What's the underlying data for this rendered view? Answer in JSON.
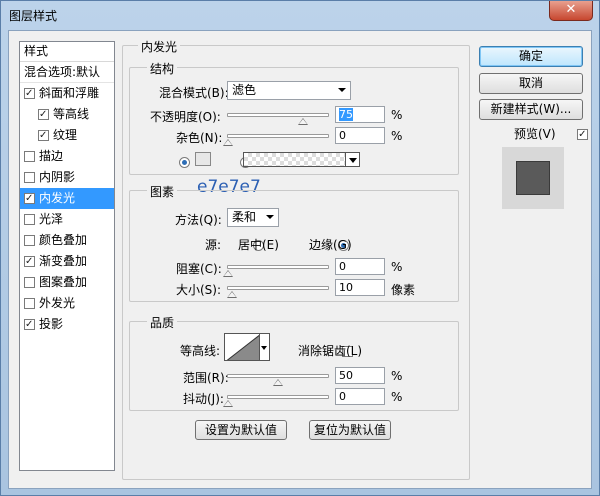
{
  "window": {
    "title": "图层样式",
    "close_glyph": "✕"
  },
  "sidebar": {
    "header": "样式",
    "blend_options": "混合选项:默认",
    "items": [
      {
        "label": "斜面和浮雕",
        "checked": true
      },
      {
        "label": "等高线",
        "checked": true
      },
      {
        "label": "纹理",
        "checked": true
      },
      {
        "label": "描边",
        "checked": false
      },
      {
        "label": "内阴影",
        "checked": false
      },
      {
        "label": "内发光",
        "checked": true,
        "selected": true
      },
      {
        "label": "光泽",
        "checked": false
      },
      {
        "label": "颜色叠加",
        "checked": false
      },
      {
        "label": "渐变叠加",
        "checked": true
      },
      {
        "label": "图案叠加",
        "checked": false
      },
      {
        "label": "外发光",
        "checked": false
      },
      {
        "label": "投影",
        "checked": true
      }
    ]
  },
  "inner_glow": {
    "title": "内发光",
    "structure": {
      "title": "结构",
      "blend_mode_label": "混合模式(B):",
      "blend_mode_value": "滤色",
      "opacity_label": "不透明度(O):",
      "opacity_value": "75",
      "opacity_level": 75,
      "noise_label": "杂色(N):",
      "noise_value": "0",
      "noise_level": 0,
      "percent": "%",
      "glow_color": "#e7e7e7",
      "color_hex_label": "e7e7e7"
    },
    "elements": {
      "title": "图素",
      "method_label": "方法(Q):",
      "method_value": "柔和",
      "source_label": "源:",
      "source_center": "居中(E)",
      "source_edge": "边缘(G)",
      "choke_label": "阻塞(C):",
      "choke_value": "0",
      "choke_level": 0,
      "size_label": "大小(S):",
      "size_value": "10",
      "size_level": 4,
      "size_unit": "像素",
      "percent": "%"
    },
    "quality": {
      "title": "品质",
      "contour_label": "等高线:",
      "antialias_label": "消除锯齿(L)",
      "antialias_checked": false,
      "range_label": "范围(R):",
      "range_value": "50",
      "range_level": 50,
      "jitter_label": "抖动(J):",
      "jitter_value": "0",
      "jitter_level": 0,
      "percent": "%"
    },
    "set_default": "设置为默认值",
    "reset_default": "复位为默认值"
  },
  "actions": {
    "ok": "确定",
    "cancel": "取消",
    "new_style": "新建样式(W)...",
    "preview_label": "预览(V)",
    "preview_checked": true
  }
}
